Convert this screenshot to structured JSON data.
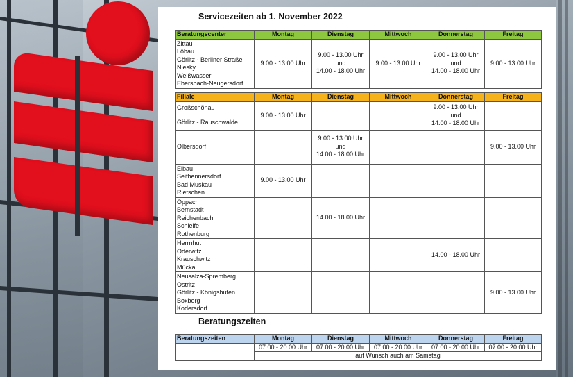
{
  "title": "Servicezeiten ab 1. November 2022",
  "days": [
    "Montag",
    "Dienstag",
    "Mittwoch",
    "Donnerstag",
    "Freitag"
  ],
  "beratungscenter": {
    "header": "Beratungscenter",
    "locations": [
      "Zittau",
      "Löbau",
      "Görlitz - Berliner Straße",
      "Niesky",
      "Weißwasser",
      "Ebersbach-Neugersdorf"
    ],
    "montag": "9.00 - 13.00 Uhr",
    "dienstag": [
      "9.00 - 13.00 Uhr",
      "und",
      "14.00 - 18.00 Uhr"
    ],
    "mittwoch": "9.00 - 13.00 Uhr",
    "donnerstag": [
      "9.00 - 13.00 Uhr",
      "und",
      "14.00 - 18.00 Uhr"
    ],
    "freitag": "9.00 - 13.00 Uhr"
  },
  "filiale": {
    "header": "Filiale",
    "groups": [
      {
        "locations": [
          "Großschönau",
          "Görlitz - Rauschwalde"
        ],
        "montag": "9.00 - 13.00 Uhr",
        "donnerstag": [
          "9.00 - 13.00 Uhr",
          "und",
          "14.00 - 18.00 Uhr"
        ]
      },
      {
        "locations": [
          "Olbersdorf"
        ],
        "dienstag": [
          "9.00 - 13.00 Uhr",
          "und",
          "14.00 - 18.00 Uhr"
        ],
        "freitag": "9.00 - 13.00 Uhr"
      },
      {
        "locations": [
          "Eibau",
          "Seifhennersdorf",
          "Bad Muskau",
          "Rietschen"
        ],
        "montag": "9.00 - 13.00 Uhr"
      },
      {
        "locations": [
          "Oppach",
          "Bernstadt",
          "Reichenbach",
          "Schleife",
          "Rothenburg"
        ],
        "dienstag": "14.00 - 18.00 Uhr"
      },
      {
        "locations": [
          "Herrnhut",
          "Oderwitz",
          "Krauschwitz",
          "Mücka"
        ],
        "donnerstag": "14.00 - 18.00 Uhr"
      },
      {
        "locations": [
          "Neusalza-Spremberg",
          "Ostritz",
          "Görlitz - Königshufen",
          "Boxberg",
          "Kodersdorf"
        ],
        "freitag": "9.00 - 13.00 Uhr"
      }
    ]
  },
  "beratungszeiten": {
    "title": "Beratungszeiten",
    "header": "Beratungszeiten",
    "times": [
      "07.00 - 20.00 Uhr",
      "07.00 - 20.00 Uhr",
      "07.00 - 20.00 Uhr",
      "07.00 - 20.00 Uhr",
      "07.00 - 20.00 Uhr"
    ],
    "note": "auf Wunsch auch am Samstag"
  },
  "colors": {
    "green": "#8dc63f",
    "orange": "#f6b21a",
    "blue": "#bcd4ee",
    "brand_red": "#e20f1d"
  }
}
